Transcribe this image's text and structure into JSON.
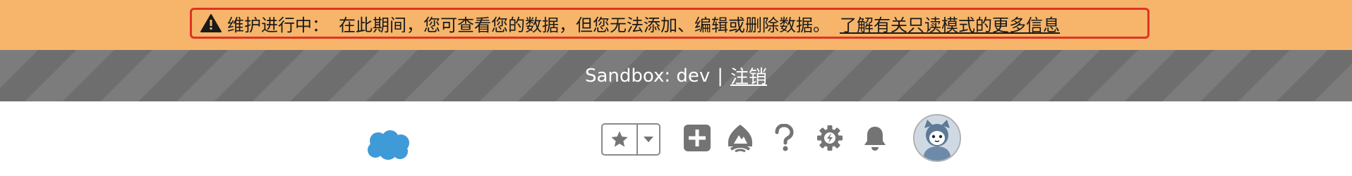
{
  "maintenance_banner": {
    "title": "维护进行中：",
    "message": "在此期间，您可查看您的数据，但您无法添加、编辑或删除数据。",
    "link_text": "了解有关只读模式的更多信息",
    "icon": "warning-icon",
    "highlight_color": "#e03325",
    "background_color": "#f6b56a"
  },
  "sandbox_bar": {
    "label": "Sandbox: dev",
    "separator": "|",
    "logout_text": "注销"
  },
  "header": {
    "logo_icon": "salesforce-cloud-logo",
    "logo_color": "#3f9ad8",
    "favorites_icon": "star-icon",
    "favorites_dropdown_icon": "caret-down-icon",
    "global_actions_icon": "add-icon",
    "trailhead_icon": "trailhead-icon",
    "help_icon": "help-icon",
    "setup_icon": "gear-icon",
    "notifications_icon": "bell-icon",
    "avatar_icon": "user-avatar",
    "icon_color": "#747474"
  }
}
